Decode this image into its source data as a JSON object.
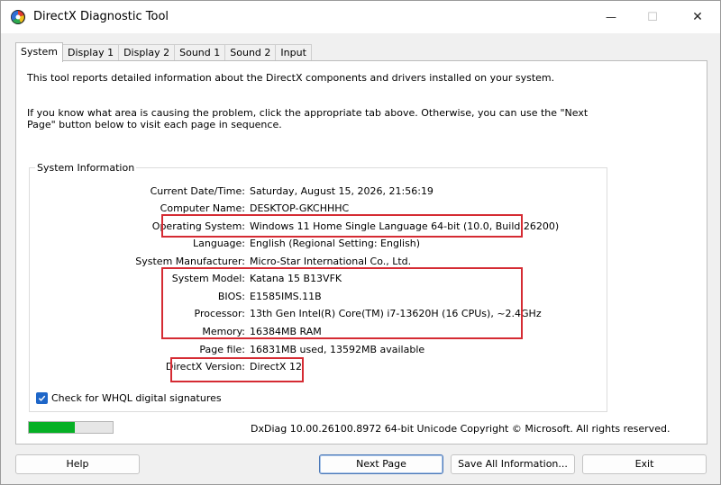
{
  "window": {
    "title": "DirectX Diagnostic Tool",
    "min_glyph": "—",
    "max_glyph": "☐",
    "close_glyph": "✕"
  },
  "tabs": [
    {
      "label": "System",
      "active": true
    },
    {
      "label": "Display 1"
    },
    {
      "label": "Display 2"
    },
    {
      "label": "Sound 1"
    },
    {
      "label": "Sound 2"
    },
    {
      "label": "Input"
    }
  ],
  "intro": {
    "line1": "This tool reports detailed information about the DirectX components and drivers installed on your system.",
    "line2": "If you know what area is causing the problem, click the appropriate tab above.  Otherwise, you can use the \"Next Page\" button below to visit each page in sequence."
  },
  "system_info": {
    "legend": "System Information",
    "rows": [
      {
        "label": "Current Date/Time:",
        "value": "Saturday, August 15, 2026, 21:56:19"
      },
      {
        "label": "Computer Name:",
        "value": "DESKTOP-GKCHHHC"
      },
      {
        "label": "Operating System:",
        "value": "Windows 11 Home Single Language 64-bit (10.0, Build 26200)"
      },
      {
        "label": "Language:",
        "value": "English (Regional Setting: English)"
      },
      {
        "label": "System Manufacturer:",
        "value": "Micro-Star International Co., Ltd."
      },
      {
        "label": "System Model:",
        "value": "Katana 15 B13VFK"
      },
      {
        "label": "BIOS:",
        "value": "E1585IMS.11B"
      },
      {
        "label": "Processor:",
        "value": "13th Gen Intel(R) Core(TM) i7-13620H (16 CPUs), ~2.4GHz"
      },
      {
        "label": "Memory:",
        "value": "16384MB RAM"
      },
      {
        "label": "Page file:",
        "value": "16831MB used, 13592MB available"
      },
      {
        "label": "DirectX Version:",
        "value": "DirectX 12"
      }
    ]
  },
  "whql": {
    "label": "Check for WHQL digital signatures",
    "checked": true
  },
  "progress": {
    "fraction": 0.55,
    "color": "#06b025"
  },
  "copyright": "DxDiag 10.00.26100.8972 64-bit Unicode  Copyright © Microsoft. All rights reserved.",
  "buttons": {
    "help": "Help",
    "next": "Next Page",
    "save": "Save All Information...",
    "exit": "Exit"
  },
  "highlight_color": "#d52b33"
}
